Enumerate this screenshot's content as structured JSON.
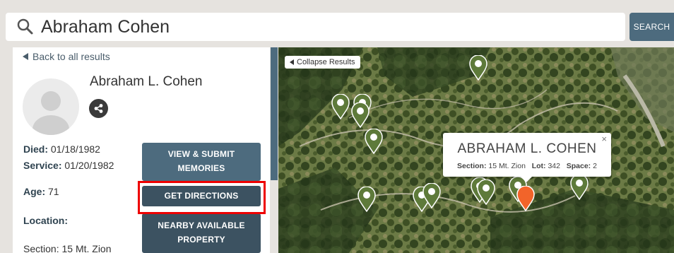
{
  "search": {
    "query": "Abraham Cohen",
    "button_label": "SEARCH"
  },
  "results_panel": {
    "back_label": "Back to all results",
    "person_name": "Abraham L. Cohen",
    "died_label": "Died:",
    "died_value": "01/18/1982",
    "service_label": "Service:",
    "service_value": "01/20/1982",
    "age_label": "Age:",
    "age_value": "71",
    "location_label": "Location:",
    "section_text": "Section: 15 Mt. Zion",
    "buttons": {
      "memories_line1": "VIEW & SUBMIT",
      "memories_line2": "MEMORIES",
      "directions": "GET DIRECTIONS",
      "nearby_line1": "NEARBY AVAILABLE",
      "nearby_line2": "PROPERTY"
    }
  },
  "map": {
    "collapse_label": "Collapse Results",
    "popup": {
      "title": "ABRAHAM L. COHEN",
      "close": "×",
      "section_label": "Section:",
      "section_value": "15 Mt. Zion",
      "lot_label": "Lot:",
      "lot_value": "342",
      "space_label": "Space:",
      "space_value": "2"
    },
    "pin_colors": {
      "default": "#5e7a3a",
      "selected": "#f2642a"
    }
  },
  "colors": {
    "accent": "#4d6b7e",
    "highlight": "#e00000"
  }
}
